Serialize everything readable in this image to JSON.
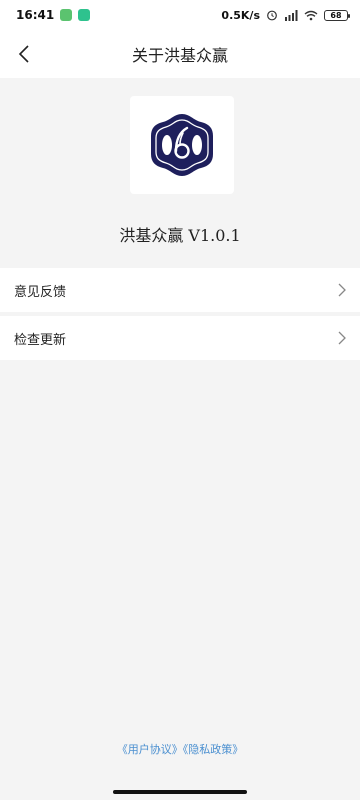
{
  "status_bar": {
    "time": "16:41",
    "speed": "0.5K/s",
    "battery": "68"
  },
  "header": {
    "title": "关于洪基众赢"
  },
  "about": {
    "app_version": "洪基众赢 V1.0.1"
  },
  "menu": {
    "items": [
      {
        "label": "意见反馈",
        "icon": "chevron-right-icon"
      },
      {
        "label": "检查更新",
        "icon": "chevron-right-icon"
      }
    ]
  },
  "footer": {
    "user_agreement": "《用户协议》",
    "privacy_policy": "《隐私政策》"
  },
  "colors": {
    "logo_navy": "#1e1f5c",
    "link_blue": "#4a8fd0",
    "background": "#f4f4f4"
  }
}
